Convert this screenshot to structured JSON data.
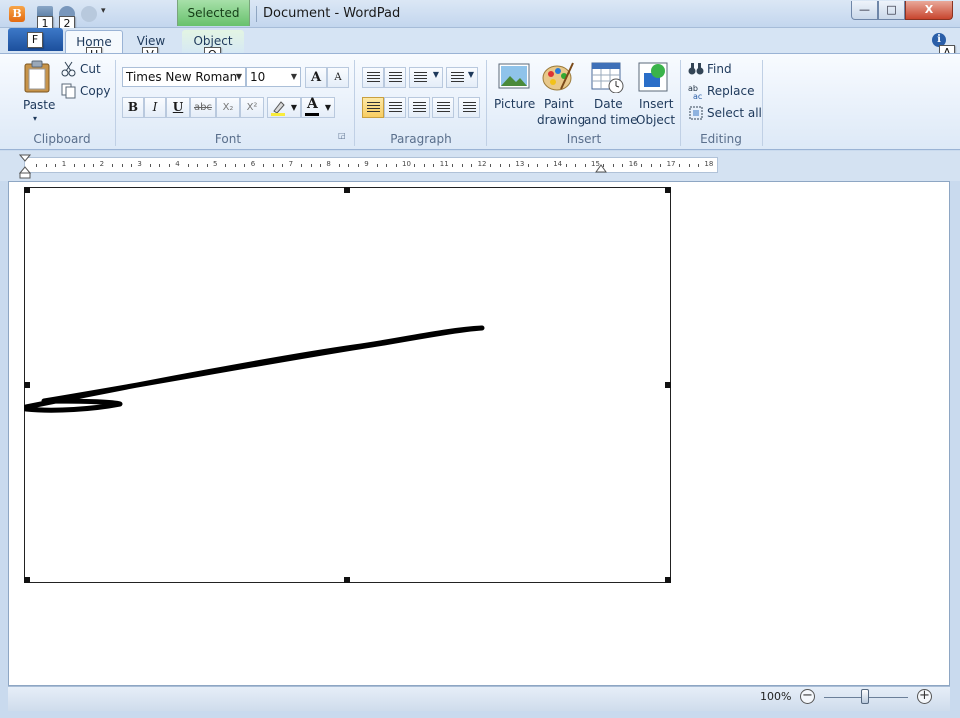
{
  "window": {
    "title": "Document - WordPad",
    "context_tab": "Selected",
    "min_glyph": "—",
    "max_glyph": "□",
    "close_glyph": "X"
  },
  "quick_access": {
    "app_icon_glyph": "B",
    "dropdown_glyph": "▾"
  },
  "keytips": {
    "qat1": "1",
    "qat2": "2",
    "file": "F",
    "home": "H",
    "view": "V",
    "object": "O",
    "help": "A"
  },
  "tabs": {
    "home": "Home",
    "view": "View",
    "object": "Object"
  },
  "help_glyph": "i",
  "clipboard": {
    "paste": "Paste",
    "cut": "Cut",
    "copy": "Copy",
    "group": "Clipboard"
  },
  "font": {
    "family": "Times New Roman",
    "size": "10",
    "grow_glyph": "A",
    "shrink_glyph": "A",
    "bold": "B",
    "italic": "I",
    "underline": "U",
    "strike": "abc",
    "subscript": "X₂",
    "superscript": "X²",
    "color_glyph": "A",
    "group": "Font"
  },
  "paragraph": {
    "group": "Paragraph"
  },
  "insert": {
    "picture": "Picture",
    "paint_line1": "Paint",
    "paint_line2": "drawing",
    "date_line1": "Date",
    "date_line2": "and time",
    "object_line1": "Insert",
    "object_line2": "Object",
    "group": "Insert"
  },
  "editing": {
    "find": "Find",
    "replace": "Replace",
    "select_all": "Select all",
    "group": "Editing"
  },
  "ruler": {
    "numbers": [
      "1",
      "2",
      "3",
      "4",
      "5",
      "6",
      "7",
      "8",
      "9",
      "10",
      "11",
      "12",
      "13",
      "14",
      "15",
      "16",
      "17",
      "18"
    ]
  },
  "status": {
    "zoom": "100%",
    "zoom_out": "−",
    "zoom_in": "+"
  },
  "colors": {
    "accent": "#1c4f9c",
    "selected_tab": "#68c16d",
    "font_color_bar": "#000000",
    "highlight_bar": "#f9ec3c"
  }
}
